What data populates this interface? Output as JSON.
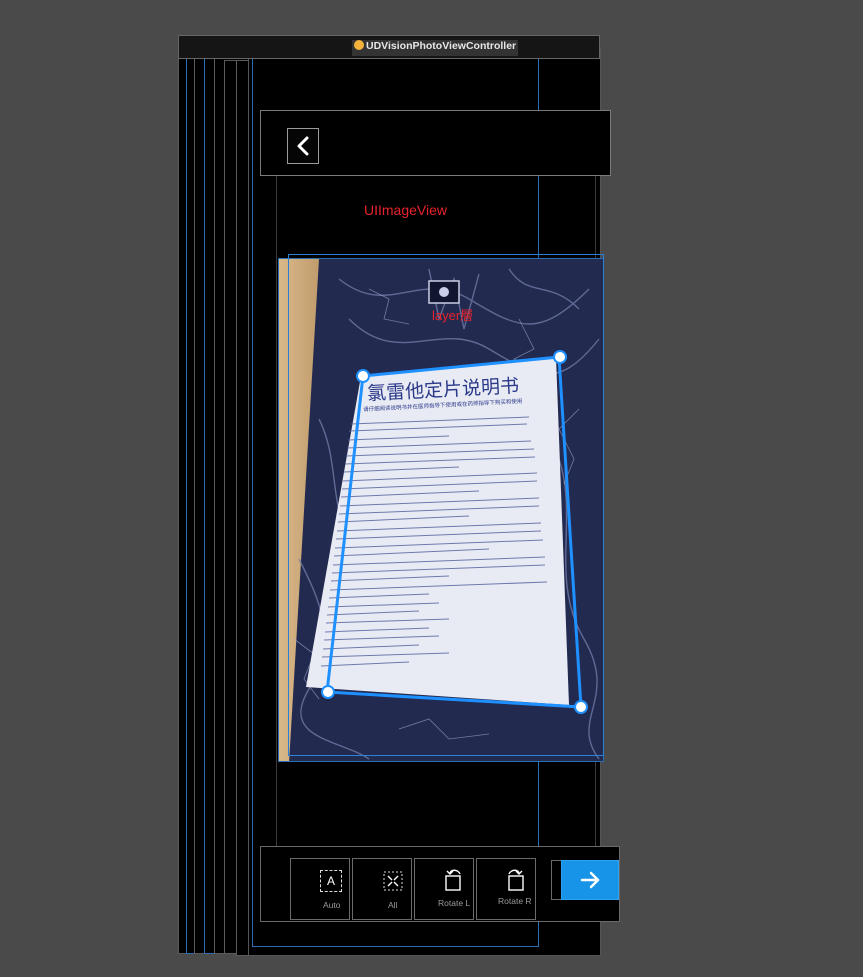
{
  "window": {
    "title": "UDVisionPhotoViewController"
  },
  "labels": {
    "image_view": "UIImageView",
    "layer": "layer層"
  },
  "nav": {
    "back_icon": "chevron-left-icon"
  },
  "document": {
    "title": "氯雷他定片说明书",
    "subtitle": "请仔细阅读说明书并在医师指导下使用或在药师指导下购买和使用"
  },
  "toolbar": {
    "items": [
      {
        "label": "Auto",
        "icon": "auto-crop-icon"
      },
      {
        "label": "All",
        "icon": "select-all-icon"
      },
      {
        "label": "Rotate L",
        "icon": "rotate-left-icon"
      },
      {
        "label": "Rotate R",
        "icon": "rotate-right-icon"
      }
    ],
    "next_icon": "arrow-right-icon"
  },
  "colors": {
    "background": "#4a4a4a",
    "accent": "#1793e8",
    "crop_line": "#1e90ff",
    "label_red": "#e8232b"
  }
}
